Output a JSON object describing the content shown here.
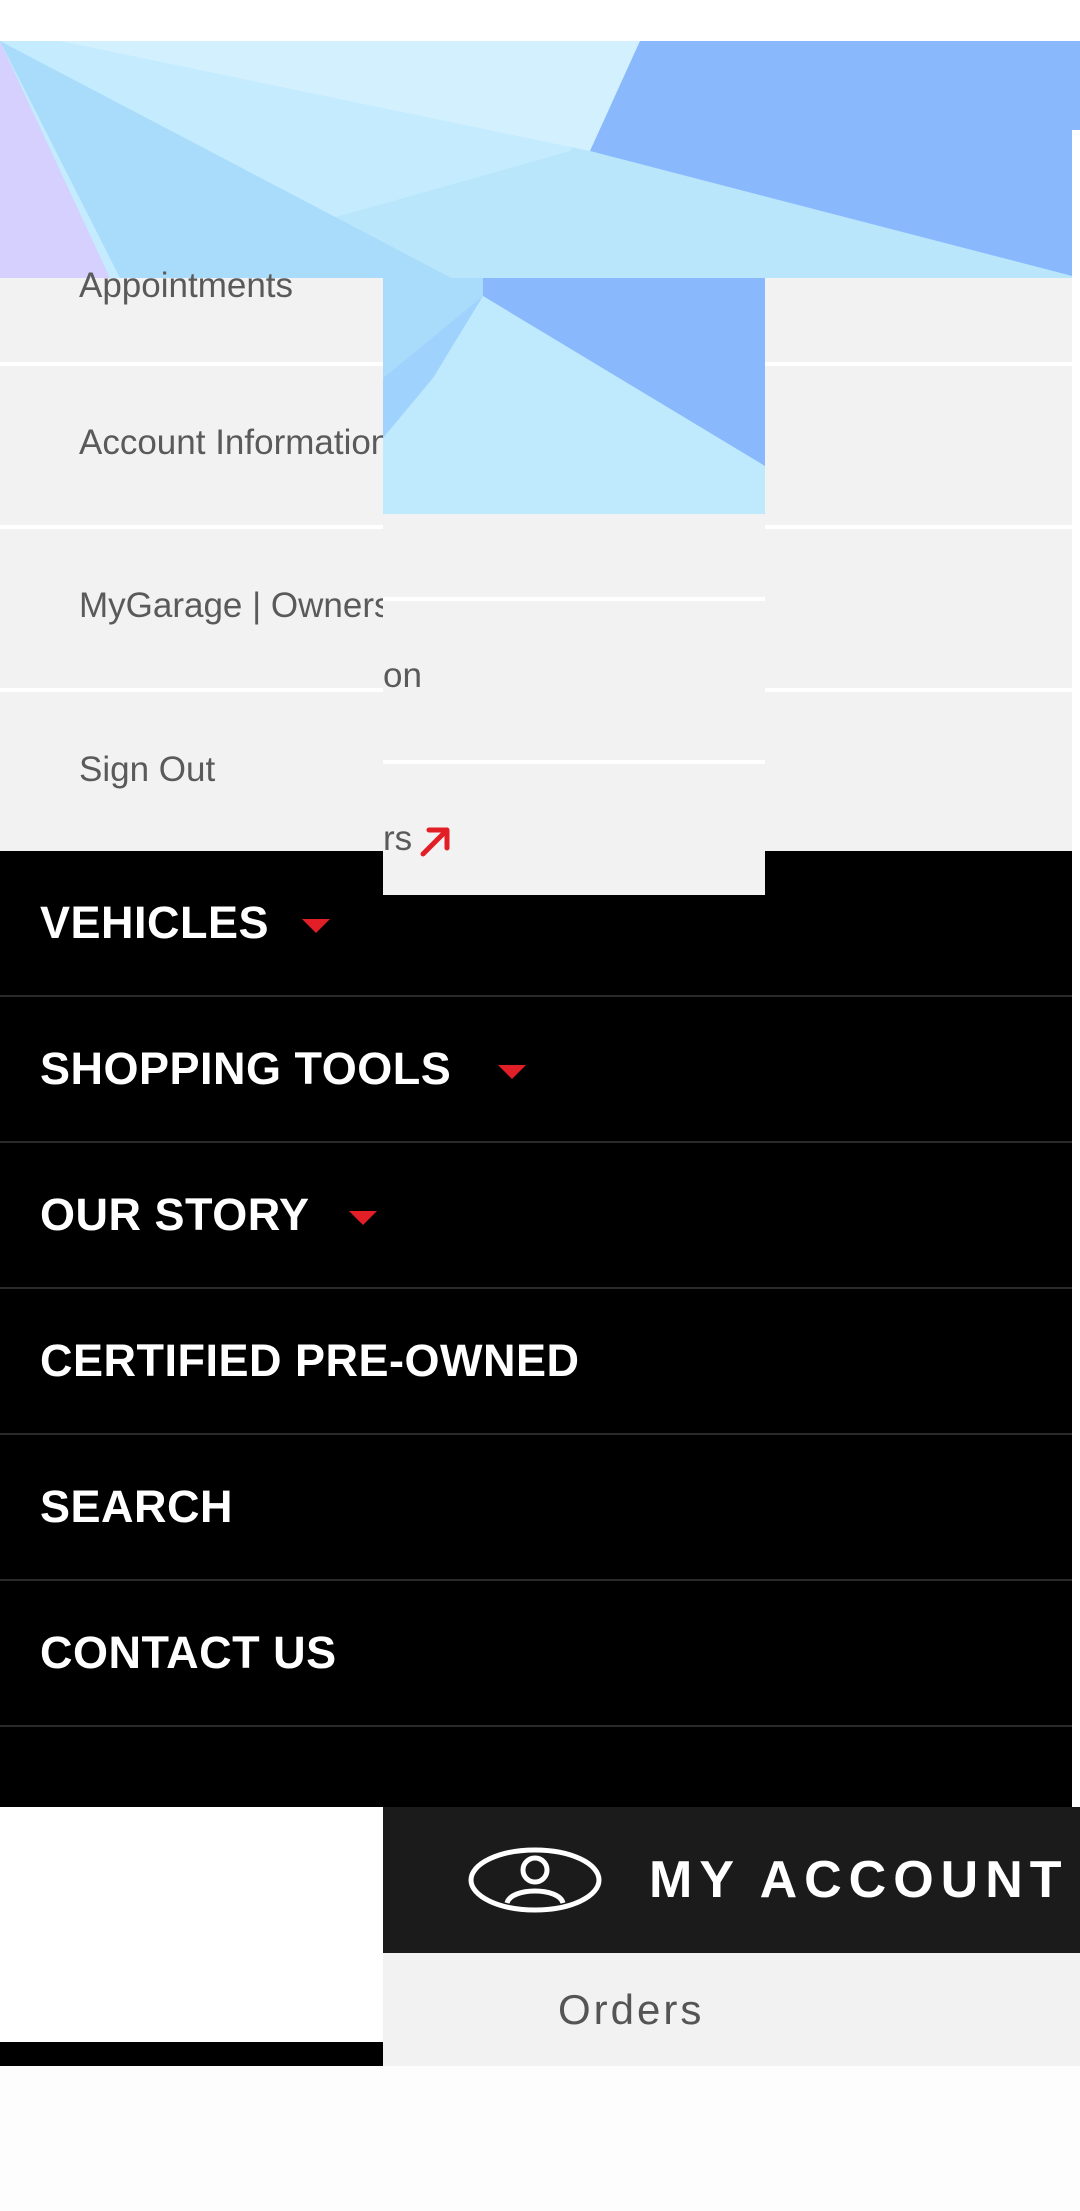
{
  "account_menu": {
    "items": [
      {
        "label": "Appointments"
      },
      {
        "label": "Account Information"
      },
      {
        "label": "MyGarage | Owners"
      },
      {
        "label": "Sign Out"
      }
    ]
  },
  "ghost_panel": {
    "fragment_1": "on",
    "fragment_2": "rs"
  },
  "main_nav": {
    "items": [
      {
        "label": "VEHICLES"
      },
      {
        "label": "SHOPPING TOOLS"
      },
      {
        "label": "OUR STORY"
      },
      {
        "label": "CERTIFIED PRE-OWNED"
      },
      {
        "label": "SEARCH"
      },
      {
        "label": "CONTACT US"
      }
    ]
  },
  "my_account": {
    "title": "MY ACCOUNT",
    "orders_label": "Orders"
  },
  "icons": {
    "dropdown": "caret-down-icon",
    "external": "external-link-icon",
    "account": "user-icon"
  },
  "colors": {
    "accent": "#e21f26",
    "nav_bg": "#000000",
    "submenu_bg": "#f2f2f2",
    "account_bar_bg": "#1b1b1b"
  }
}
